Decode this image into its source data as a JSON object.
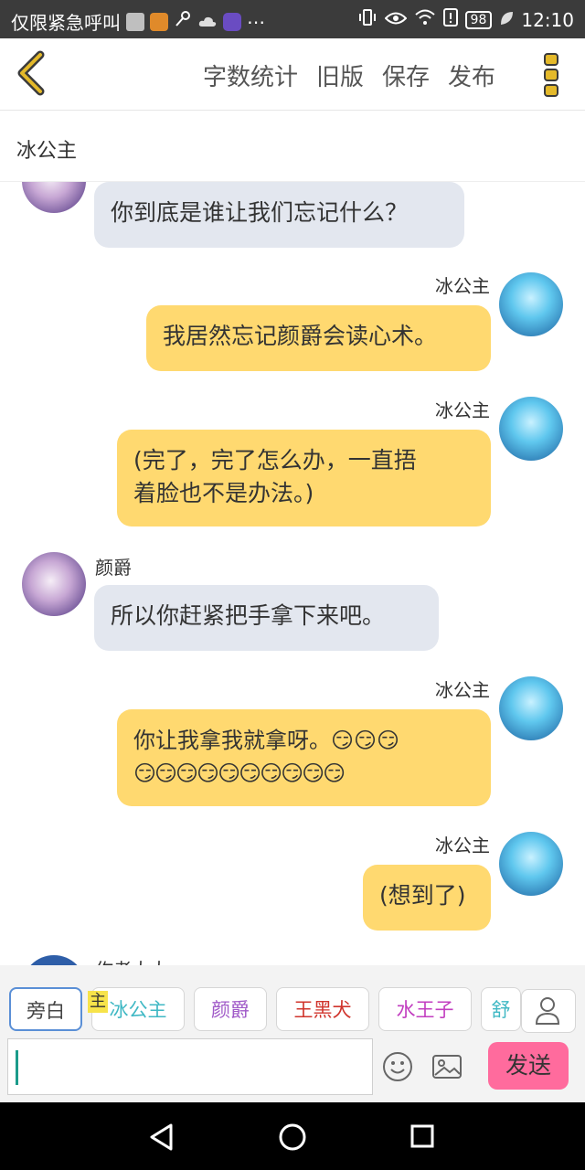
{
  "status_bar": {
    "carrier": "仅限紧急呼叫",
    "battery": "98",
    "time": "12:10",
    "icons": [
      "square-icon",
      "play-icon",
      "key-icon",
      "cloud-icon",
      "app-icon",
      "more-dots",
      "vibrate-icon",
      "eye-icon",
      "wifi-icon",
      "sim-alert-icon",
      "battery-icon",
      "leaf-icon"
    ]
  },
  "header": {
    "actions": [
      "字数统计",
      "旧版",
      "保存",
      "发布"
    ],
    "subtitle": "冰公主"
  },
  "messages": [
    {
      "side": "left",
      "avatar": "yanjue",
      "name": "",
      "lines": [
        "你到底是谁让我们忘记什么？"
      ]
    },
    {
      "side": "right",
      "avatar": "ice",
      "name": "冰公主",
      "lines": [
        "我居然忘记颜爵会读心术。"
      ]
    },
    {
      "side": "right",
      "avatar": "ice",
      "name": "冰公主",
      "lines": [
        "(完了，完了怎么办，一直捂",
        "着脸也不是办法。)"
      ]
    },
    {
      "side": "left",
      "avatar": "yanjue",
      "name": "颜爵",
      "lines": [
        "所以你赶紧把手拿下来吧。"
      ]
    },
    {
      "side": "right",
      "avatar": "ice",
      "name": "冰公主",
      "lines": [
        "你让我拿我就拿呀。😏😏😏",
        "😏😏😏😏😏😏😏😏😏😏"
      ]
    },
    {
      "side": "right",
      "avatar": "ice",
      "name": "冰公主",
      "lines": [
        "(想到了)"
      ]
    },
    {
      "side": "left",
      "avatar": "author",
      "name": "作者大大",
      "lines": []
    }
  ],
  "roles": [
    {
      "label": "旁白",
      "color": "#444444"
    },
    {
      "label": "冰公主",
      "color": "#3fb8c4"
    },
    {
      "label": "颜爵",
      "color": "#a05ac8"
    },
    {
      "label": "王黑犬",
      "color": "#d0342c"
    },
    {
      "label": "水王子",
      "color": "#c23ec0"
    },
    {
      "label": "舒",
      "color": "#3fb8c4"
    }
  ],
  "role_tag": "主",
  "input": {
    "value": "",
    "send_label": "发送"
  },
  "colors": {
    "bubble_right": "#ffd970",
    "bubble_left": "#e3e7ef",
    "send": "#ff6b9d",
    "accent_back": "#e4b92a"
  }
}
